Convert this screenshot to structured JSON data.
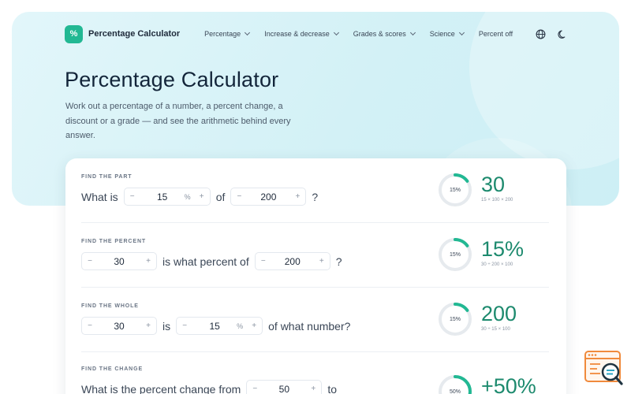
{
  "nav": {
    "logo_glyph": "%",
    "brand": "Percentage Calculator",
    "menu": [
      {
        "label": "Percentage",
        "has_dropdown": true
      },
      {
        "label": "Increase & decrease",
        "has_dropdown": true
      },
      {
        "label": "Grades & scores",
        "has_dropdown": true
      },
      {
        "label": "Science",
        "has_dropdown": true
      },
      {
        "label": "Percent off",
        "has_dropdown": false
      }
    ],
    "icons": [
      "globe-icon",
      "moon-icon"
    ]
  },
  "hero": {
    "title": "Percentage Calculator",
    "subtitle": "Work out a percentage of a number, a percent change, a discount or a grade — and see the arithmetic behind every answer."
  },
  "calculators": [
    {
      "label": "FIND THE PART",
      "text": {
        "pre": "What is",
        "mid": "of",
        "post": "?"
      },
      "inputs": [
        {
          "value": "15",
          "unit": "%"
        },
        {
          "value": "200",
          "unit": ""
        }
      ],
      "result": {
        "ring_label": "15%",
        "progress": 0.15,
        "value": "30",
        "formula": "15 × 100 × 200"
      }
    },
    {
      "label": "FIND THE PERCENT",
      "text": {
        "mid": "is what percent of",
        "post": "?"
      },
      "inputs": [
        {
          "value": "30",
          "unit": ""
        },
        {
          "value": "200",
          "unit": ""
        }
      ],
      "result": {
        "ring_label": "15%",
        "progress": 0.15,
        "value": "15%",
        "formula": "30 ÷ 200 × 100"
      }
    },
    {
      "label": "FIND THE WHOLE",
      "text": {
        "mid": "is",
        "post": "of what number?"
      },
      "inputs": [
        {
          "value": "30",
          "unit": ""
        },
        {
          "value": "15",
          "unit": "%"
        }
      ],
      "result": {
        "ring_label": "15%",
        "progress": 0.15,
        "value": "200",
        "formula": "30 ÷ 15 × 100"
      }
    },
    {
      "label": "FIND THE CHANGE",
      "text": {
        "pre": "What is the percent change from",
        "mid": "to"
      },
      "inputs": [
        {
          "value": "50",
          "unit": ""
        }
      ],
      "result": {
        "ring_label": "50%",
        "progress": 0.5,
        "value": "+50%"
      }
    }
  ],
  "stepper_symbols": {
    "minus": "−",
    "plus": "+"
  },
  "colors": {
    "accent": "#22b893",
    "result_text": "#1d8a6e",
    "hero_bg": "#d6f2f7",
    "ring_track": "#e6eaee",
    "helper_orange": "#f08a3c"
  }
}
